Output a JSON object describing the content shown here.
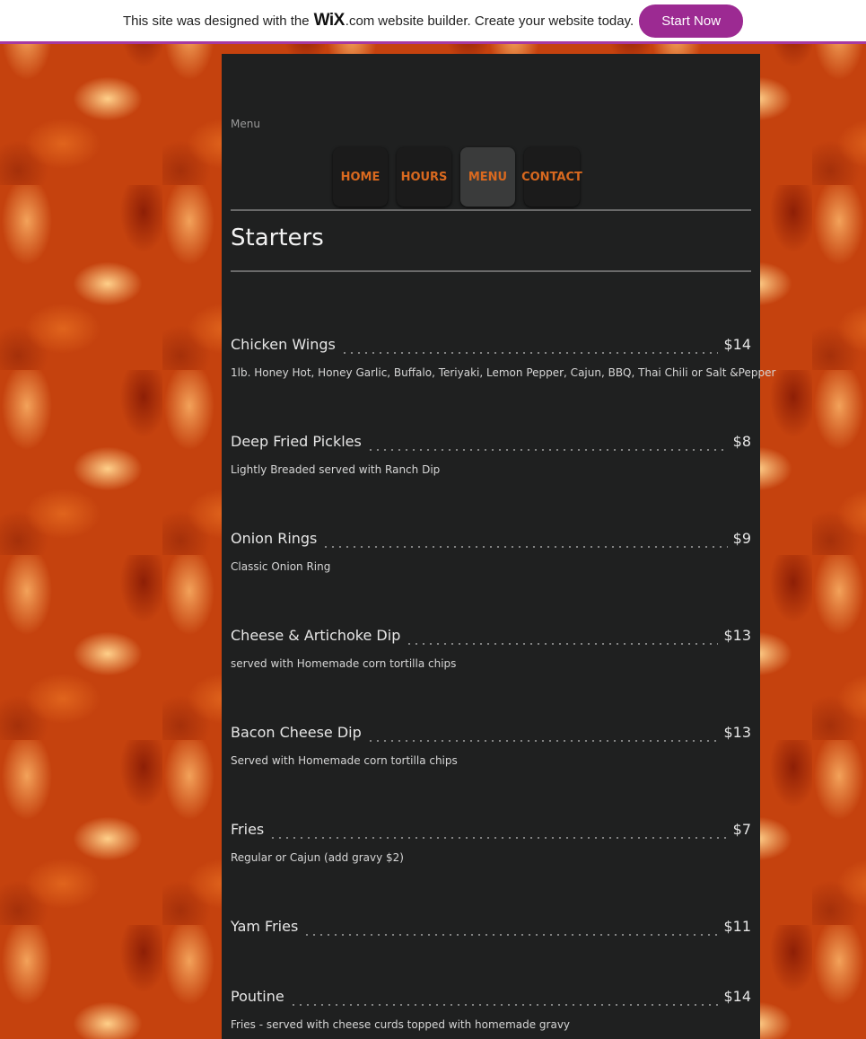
{
  "wix_bar": {
    "text_before": "This site was designed with the",
    "logo": "WiX",
    "logo_suffix": ".com",
    "text_after": "website builder. Create your website today.",
    "cta": "Start Now"
  },
  "breadcrumb": "Menu",
  "nav": [
    {
      "label": "HOME"
    },
    {
      "label": "HOURS"
    },
    {
      "label": "MENU",
      "active": true
    },
    {
      "label": "CONTACT"
    }
  ],
  "section_title": "Starters",
  "items": [
    {
      "name": "Chicken Wings",
      "price": "$14",
      "desc": "1lb. Honey Hot, Honey Garlic, Buffalo, Teriyaki, Lemon Pepper, Cajun, BBQ, Thai Chili or Salt &Pepper"
    },
    {
      "name": "Deep Fried Pickles",
      "price": "$8",
      "desc": "Lightly Breaded served with Ranch Dip"
    },
    {
      "name": "Onion Rings",
      "price": "$9",
      "desc": "Classic Onion Ring"
    },
    {
      "name": "Cheese & Artichoke Dip",
      "price": "$13",
      "desc": "served with Homemade corn tortilla chips"
    },
    {
      "name": "Bacon Cheese Dip",
      "price": "$13",
      "desc": "Served with Homemade corn tortilla chips"
    },
    {
      "name": "Fries",
      "price": "$7",
      "desc": "Regular or Cajun (add gravy $2)"
    },
    {
      "name": "Yam Fries",
      "price": "$11",
      "desc": ""
    },
    {
      "name": "Poutine",
      "price": "$14",
      "desc": "Fries - served with cheese curds topped with homemade gravy"
    }
  ],
  "colors": {
    "nav_text": "#d9691f",
    "wix_button": "#9c2a92",
    "panel": "#1f2020"
  }
}
